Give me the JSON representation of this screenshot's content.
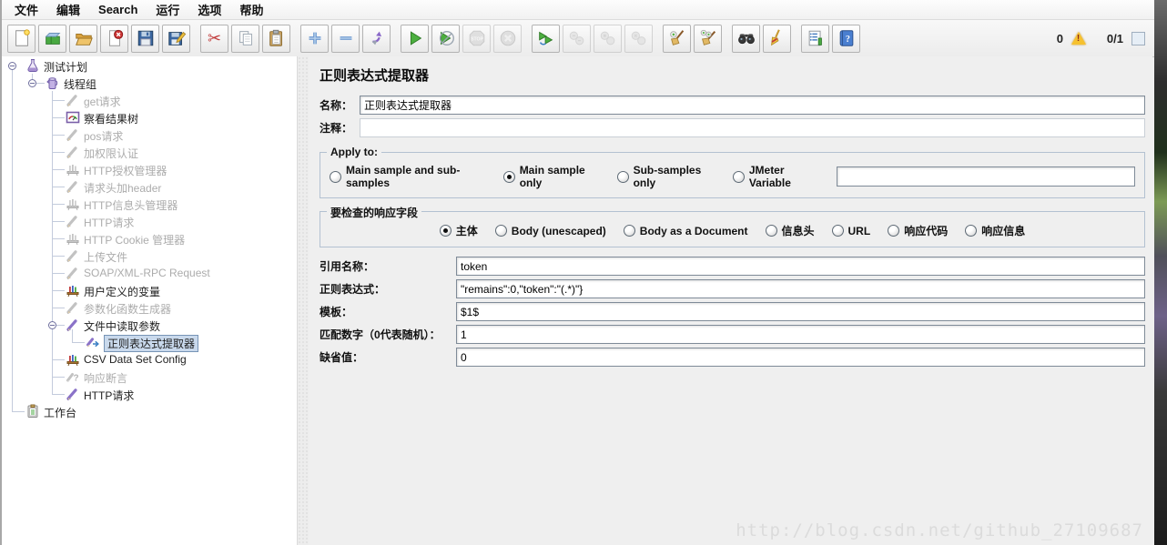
{
  "menu": {
    "items": [
      {
        "name": "file",
        "label": "文件"
      },
      {
        "name": "edit",
        "label": "编辑"
      },
      {
        "name": "search",
        "label": "Search"
      },
      {
        "name": "run",
        "label": "运行"
      },
      {
        "name": "options",
        "label": "选项"
      },
      {
        "name": "help",
        "label": "帮助"
      }
    ]
  },
  "toolbar": {
    "groups": [
      [
        {
          "name": "new",
          "enabled": true
        },
        {
          "name": "templates",
          "enabled": true
        },
        {
          "name": "open",
          "enabled": true
        },
        {
          "name": "close",
          "enabled": true
        },
        {
          "name": "save",
          "enabled": true
        },
        {
          "name": "save-as",
          "enabled": true
        }
      ],
      [
        {
          "name": "cut",
          "enabled": true
        },
        {
          "name": "copy",
          "enabled": true
        },
        {
          "name": "paste",
          "enabled": true
        }
      ],
      [
        {
          "name": "expand-all",
          "enabled": true
        },
        {
          "name": "collapse-all",
          "enabled": true
        },
        {
          "name": "toggle",
          "enabled": true
        }
      ],
      [
        {
          "name": "start",
          "enabled": true
        },
        {
          "name": "start-no-pauses",
          "enabled": true
        },
        {
          "name": "stop",
          "enabled": false
        },
        {
          "name": "shutdown",
          "enabled": false
        }
      ],
      [
        {
          "name": "remote-start",
          "enabled": true
        },
        {
          "name": "remote-start-all",
          "enabled": false
        },
        {
          "name": "remote-stop",
          "enabled": false
        },
        {
          "name": "remote-shutdown",
          "enabled": false
        }
      ],
      [
        {
          "name": "clear",
          "enabled": true
        },
        {
          "name": "clear-all",
          "enabled": true
        }
      ],
      [
        {
          "name": "search",
          "enabled": true
        },
        {
          "name": "search-reset",
          "enabled": true
        }
      ],
      [
        {
          "name": "function-helper",
          "enabled": true
        },
        {
          "name": "help",
          "enabled": true
        }
      ]
    ],
    "warning_count": "0",
    "thread_counter": "0/1"
  },
  "tree": {
    "items": [
      {
        "name": "test-plan",
        "label": "测试计划",
        "icon": "test-plan",
        "level": 0,
        "enabled": true,
        "handle": true
      },
      {
        "name": "thread-group",
        "label": "线程组",
        "icon": "thread-group",
        "level": 1,
        "enabled": true,
        "handle": true
      },
      {
        "name": "get-request",
        "label": "get请求",
        "icon": "sampler",
        "level": 2,
        "enabled": false
      },
      {
        "name": "view-results-tree",
        "label": "察看结果树",
        "icon": "results-tree",
        "level": 2,
        "enabled": true
      },
      {
        "name": "pos-request",
        "label": "pos请求",
        "icon": "sampler",
        "level": 2,
        "enabled": false
      },
      {
        "name": "auth-verify",
        "label": "加权限认证",
        "icon": "sampler",
        "level": 2,
        "enabled": false
      },
      {
        "name": "http-auth-manager",
        "label": "HTTP授权管理器",
        "icon": "manager",
        "level": 2,
        "enabled": false
      },
      {
        "name": "request-header-add",
        "label": "请求头加header",
        "icon": "sampler",
        "level": 2,
        "enabled": false
      },
      {
        "name": "http-header-manager",
        "label": "HTTP信息头管理器",
        "icon": "manager",
        "level": 2,
        "enabled": false
      },
      {
        "name": "http-request-1",
        "label": "HTTP请求",
        "icon": "sampler",
        "level": 2,
        "enabled": false
      },
      {
        "name": "http-cookie-manager",
        "label": "HTTP Cookie 管理器",
        "icon": "manager",
        "level": 2,
        "enabled": false
      },
      {
        "name": "upload-file",
        "label": "上传文件",
        "icon": "sampler",
        "level": 2,
        "enabled": false
      },
      {
        "name": "soap-xmlrpc-request",
        "label": "SOAP/XML-RPC Request",
        "icon": "sampler",
        "level": 2,
        "enabled": false
      },
      {
        "name": "user-defined-variables",
        "label": "用户定义的变量",
        "icon": "variables",
        "level": 2,
        "enabled": true
      },
      {
        "name": "param-func-generator",
        "label": "参数化函数生成器",
        "icon": "sampler",
        "level": 2,
        "enabled": false
      },
      {
        "name": "file-read-params",
        "label": "文件中读取参数",
        "icon": "sampler",
        "level": 2,
        "enabled": true,
        "handle": true
      },
      {
        "name": "regex-extractor",
        "label": "正则表达式提取器",
        "icon": "extractor",
        "level": 3,
        "enabled": true,
        "selected": true
      },
      {
        "name": "csv-data-set-config",
        "label": "CSV Data Set Config",
        "icon": "variables",
        "level": 2,
        "enabled": true
      },
      {
        "name": "response-assertion",
        "label": "响应断言",
        "icon": "assertion",
        "level": 2,
        "enabled": false
      },
      {
        "name": "http-request-2",
        "label": "HTTP请求",
        "icon": "sampler",
        "level": 2,
        "enabled": true
      },
      {
        "name": "workbench",
        "label": "工作台",
        "icon": "workbench",
        "level": 0,
        "enabled": true
      }
    ]
  },
  "panel": {
    "title": "正则表达式提取器",
    "name_label": "名称：",
    "name_value": "正则表达式提取器",
    "comment_label": "注释：",
    "comment_value": "",
    "apply_to": {
      "title": "Apply to:",
      "options": [
        {
          "name": "main-and-sub",
          "label": "Main sample and sub-samples",
          "selected": false
        },
        {
          "name": "main-only",
          "label": "Main sample only",
          "selected": true
        },
        {
          "name": "sub-only",
          "label": "Sub-samples only",
          "selected": false
        },
        {
          "name": "jmeter-variable",
          "label": "JMeter Variable",
          "selected": false
        }
      ],
      "variable_value": ""
    },
    "response_field": {
      "title": "要检查的响应字段",
      "options": [
        {
          "name": "body",
          "label": "主体",
          "selected": true
        },
        {
          "name": "body-unescaped",
          "label": "Body (unescaped)",
          "selected": false
        },
        {
          "name": "body-as-document",
          "label": "Body as a Document",
          "selected": false
        },
        {
          "name": "headers",
          "label": "信息头",
          "selected": false
        },
        {
          "name": "url",
          "label": "URL",
          "selected": false
        },
        {
          "name": "response-code",
          "label": "响应代码",
          "selected": false
        },
        {
          "name": "response-message",
          "label": "响应信息",
          "selected": false
        }
      ]
    },
    "rows": [
      {
        "name": "reference-name",
        "label": "引用名称：",
        "value": "token"
      },
      {
        "name": "regex",
        "label": "正则表达式：",
        "value": "\"remains\":0,\"token\":\"(.*)\"}"
      },
      {
        "name": "template",
        "label": "模板：",
        "value": "$1$"
      },
      {
        "name": "match-no",
        "label": "匹配数字（0代表随机）：",
        "value": "1"
      },
      {
        "name": "default-value",
        "label": "缺省值：",
        "value": "0"
      }
    ]
  },
  "watermark": {
    "text": "http://blog.csdn.net/github_27109687"
  },
  "colors": {
    "selection_bg": "#C9D9EC",
    "selection_border": "#7794B6",
    "warning": "#F6C12F",
    "accent_purple": "#8A72C8",
    "start_green": "#4CAF3F"
  }
}
